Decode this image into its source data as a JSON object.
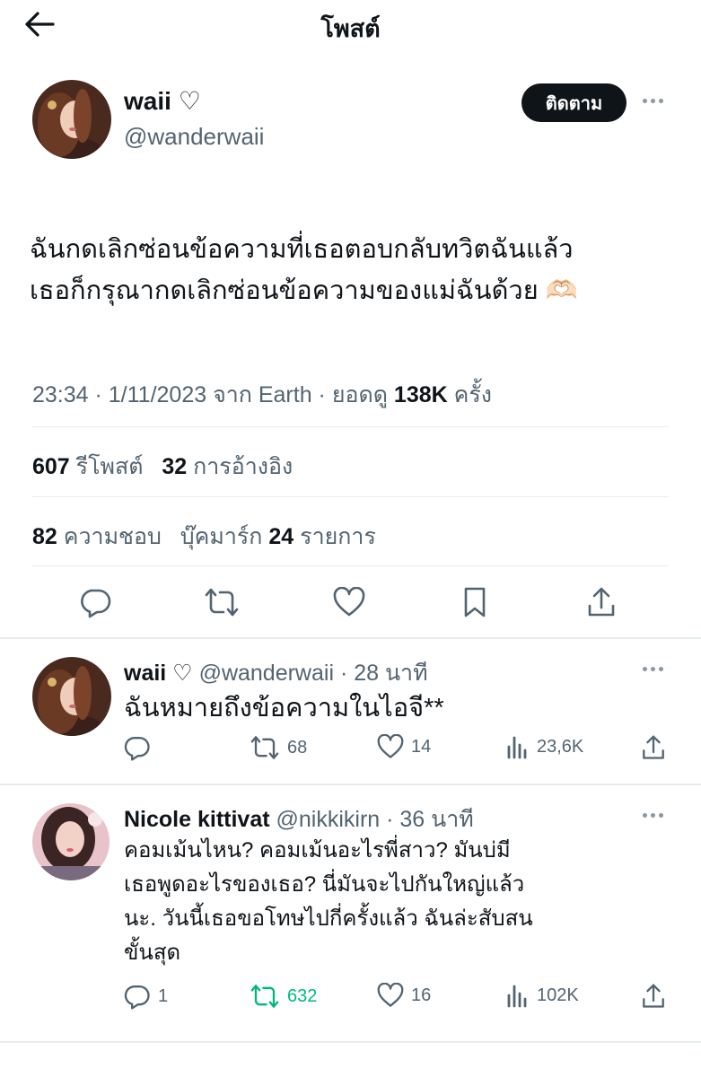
{
  "header": {
    "title": "โพสต์"
  },
  "post": {
    "author_name": "waii ♡",
    "author_handle": "@wanderwaii",
    "follow_label": "ติดตาม",
    "text_line1": "ฉันกดเลิกซ่อนข้อความที่เธอตอบกลับทวิตฉันแล้ว",
    "text_line2": "เธอก็กรุณากดเลิกซ่อนข้อความของแม่ฉันด้วย 🫶🏻",
    "time": "23:34 · 1/11/2023 จาก Earth · ยอดดู",
    "views": "138K",
    "views_suffix": "ครั้ง",
    "reposts_count": "607",
    "reposts_label": "รีโพสต์",
    "quotes_count": "32",
    "quotes_label": "การอ้างอิง",
    "likes_count": "82",
    "likes_label": "ความชอบ",
    "bookmarks_label": "บุ๊คมาร์ก",
    "bookmarks_count": "24",
    "bookmarks_suffix": "รายการ"
  },
  "replies": [
    {
      "name": "waii ♡",
      "handle_time": "@wanderwaii · 28 นาที",
      "text": "ฉันหมายถึงข้อความในไอจี**",
      "reply_count": "",
      "retweets": "68",
      "likes": "14",
      "views": "23,6K"
    },
    {
      "name": "Nicole kittivat",
      "handle_time": "@nikkikirn · 36 นาที",
      "text_line1": "คอมเม้นไหน? คอมเม้นอะไรพี่สาว? มันบ่มี",
      "text_line2": "เธอพูดอะไรของเธอ? นี่มันจะไปกันใหญ่แล้ว",
      "text_line3": "นะ. วันนี้เธอขอโทษไปกี่ครั้งแล้ว ฉันล่ะสับสน",
      "text_line4": "ขั้นสุด",
      "reply_count": "1",
      "retweets": "632",
      "likes": "16",
      "views": "102K"
    }
  ],
  "colors": {
    "text": "#0f1419",
    "secondary": "#536471",
    "retweet_green": "#00ba7c",
    "divider": "#e6ecf0"
  }
}
